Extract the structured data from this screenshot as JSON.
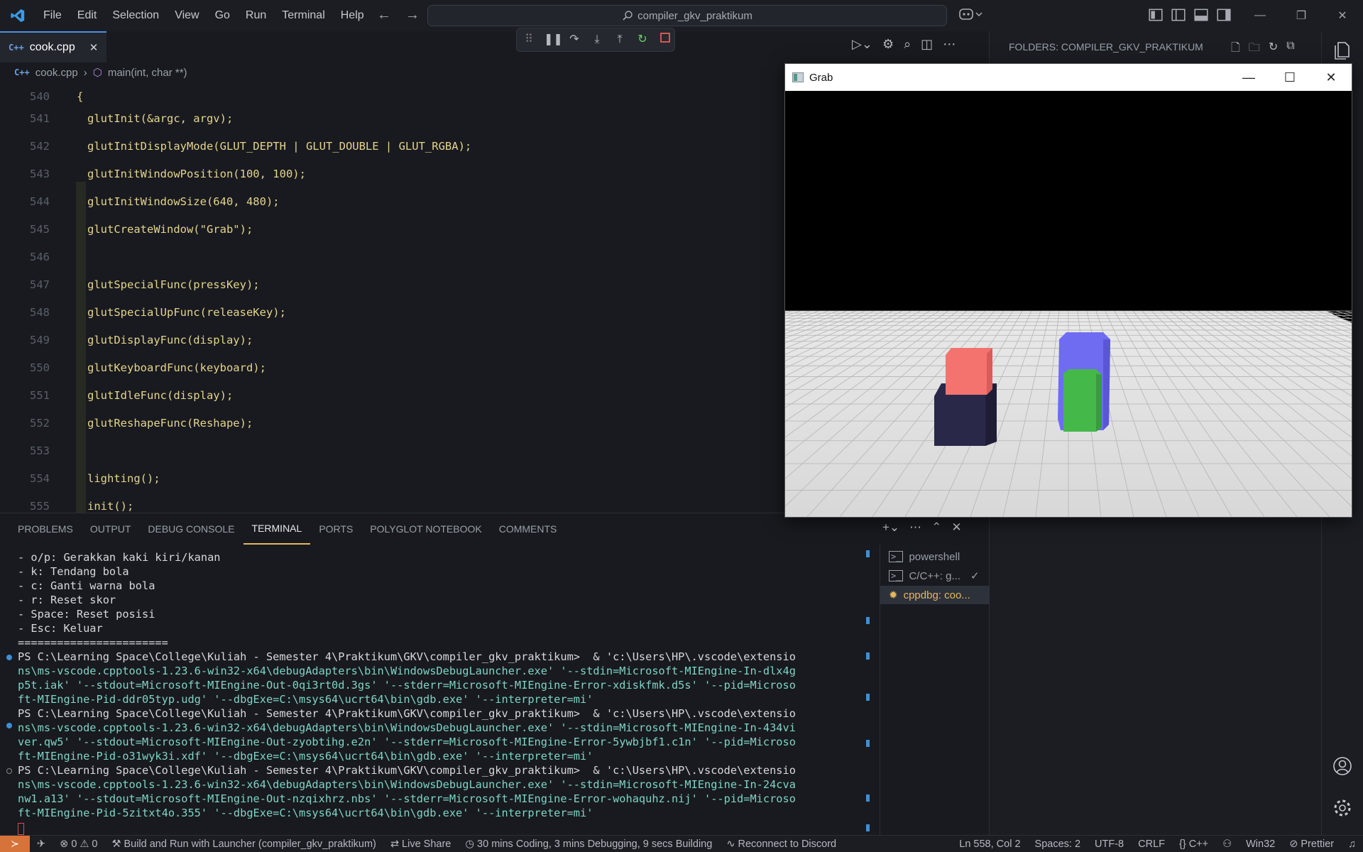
{
  "titlebar": {
    "menu": [
      "File",
      "Edit",
      "Selection",
      "View",
      "Go",
      "Run",
      "Terminal",
      "Help"
    ],
    "search_text": "compiler_gkv_praktikum"
  },
  "editor": {
    "tab_label": "cook.cpp",
    "breadcrumb_file": "cook.cpp",
    "breadcrumb_symbol": "main(int, char **)",
    "lines": [
      {
        "n": "540",
        "code": "{"
      },
      {
        "n": "541",
        "code": "glutInit(&argc, argv);"
      },
      {
        "n": "542",
        "code": "glutInitDisplayMode(GLUT_DEPTH | GLUT_DOUBLE | GLUT_RGBA);"
      },
      {
        "n": "543",
        "code": "glutInitWindowPosition(100, 100);"
      },
      {
        "n": "544",
        "code": "glutInitWindowSize(640, 480);"
      },
      {
        "n": "545",
        "code": "glutCreateWindow(\"Grab\");"
      },
      {
        "n": "546",
        "code": ""
      },
      {
        "n": "547",
        "code": "glutSpecialFunc(pressKey);"
      },
      {
        "n": "548",
        "code": "glutSpecialUpFunc(releaseKey);"
      },
      {
        "n": "549",
        "code": "glutDisplayFunc(display);"
      },
      {
        "n": "550",
        "code": "glutKeyboardFunc(keyboard);"
      },
      {
        "n": "551",
        "code": "glutIdleFunc(display);"
      },
      {
        "n": "552",
        "code": "glutReshapeFunc(Reshape);"
      },
      {
        "n": "553",
        "code": ""
      },
      {
        "n": "554",
        "code": "lighting();"
      },
      {
        "n": "555",
        "code": "init();"
      }
    ]
  },
  "grab_window": {
    "title": "Grab"
  },
  "explorer": {
    "title": "FOLDERS: COMPILER_GKV_PRAKTIKUM"
  },
  "panel": {
    "tabs": [
      "PROBLEMS",
      "OUTPUT",
      "DEBUG CONSOLE",
      "TERMINAL",
      "PORTS",
      "POLYGLOT NOTEBOOK",
      "COMMENTS"
    ],
    "active_tab": "TERMINAL",
    "terminal_lines": [
      "- o/p: Gerakkan kaki kiri/kanan",
      "- k: Tendang bola",
      "- c: Ganti warna bola",
      "- r: Reset skor",
      "- Space: Reset posisi",
      "- Esc: Keluar",
      "=======================",
      "PS C:\\Learning Space\\College\\Kuliah - Semester 4\\Praktikum\\GKV\\compiler_gkv_praktikum>  & 'c:\\Users\\HP\\.vscode\\extensio",
      "ns\\ms-vscode.cpptools-1.23.6-win32-x64\\debugAdapters\\bin\\WindowsDebugLauncher.exe' '--stdin=Microsoft-MIEngine-In-dlx4g",
      "p5t.iak' '--stdout=Microsoft-MIEngine-Out-0qi3rt0d.3gs' '--stderr=Microsoft-MIEngine-Error-xdiskfmk.d5s' '--pid=Microso",
      "ft-MIEngine-Pid-ddr05typ.udg' '--dbgExe=C:\\msys64\\ucrt64\\bin\\gdb.exe' '--interpreter=mi'",
      "PS C:\\Learning Space\\College\\Kuliah - Semester 4\\Praktikum\\GKV\\compiler_gkv_praktikum>  & 'c:\\Users\\HP\\.vscode\\extensio",
      "ns\\ms-vscode.cpptools-1.23.6-win32-x64\\debugAdapters\\bin\\WindowsDebugLauncher.exe' '--stdin=Microsoft-MIEngine-In-434vi",
      "ver.qw5' '--stdout=Microsoft-MIEngine-Out-zyobtihg.e2n' '--stderr=Microsoft-MIEngine-Error-5ywbjbf1.c1n' '--pid=Microso",
      "ft-MIEngine-Pid-o31wyk3i.xdf' '--dbgExe=C:\\msys64\\ucrt64\\bin\\gdb.exe' '--interpreter=mi'",
      "PS C:\\Learning Space\\College\\Kuliah - Semester 4\\Praktikum\\GKV\\compiler_gkv_praktikum>  & 'c:\\Users\\HP\\.vscode\\extensio",
      "ns\\ms-vscode.cpptools-1.23.6-win32-x64\\debugAdapters\\bin\\WindowsDebugLauncher.exe' '--stdin=Microsoft-MIEngine-In-24cva",
      "nw1.a13' '--stdout=Microsoft-MIEngine-Out-nzqixhrz.nbs' '--stderr=Microsoft-MIEngine-Error-wohaquhz.nij' '--pid=Microso",
      "ft-MIEngine-Pid-5zitxt4o.355' '--dbgExe=C:\\msys64\\ucrt64\\bin\\gdb.exe' '--interpreter=mi'"
    ],
    "terminal_list": [
      {
        "label": "powershell"
      },
      {
        "label": "C/C++: g..."
      },
      {
        "label": "cppdbg: coo..."
      }
    ]
  },
  "statusbar": {
    "problems": "0",
    "warnings": "0",
    "build_label": "Build and Run with Launcher (compiler_gkv_praktikum)",
    "live_share": "Live Share",
    "coding_time": "30 mins Coding, 3 mins Debugging, 9 secs Building",
    "discord": "Reconnect to Discord",
    "position": "Ln 558, Col 2",
    "spaces": "Spaces: 2",
    "encoding": "UTF-8",
    "eol": "CRLF",
    "language": "C++",
    "platform": "Win32",
    "formatter": "Prettier"
  },
  "colors": {
    "accent": "#e5b85b",
    "remote": "#d6733a",
    "cube_red": "#f4736e",
    "cube_dark": "#2a2848",
    "cube_blue": "#6f6cf2",
    "cube_green": "#45b84a"
  }
}
